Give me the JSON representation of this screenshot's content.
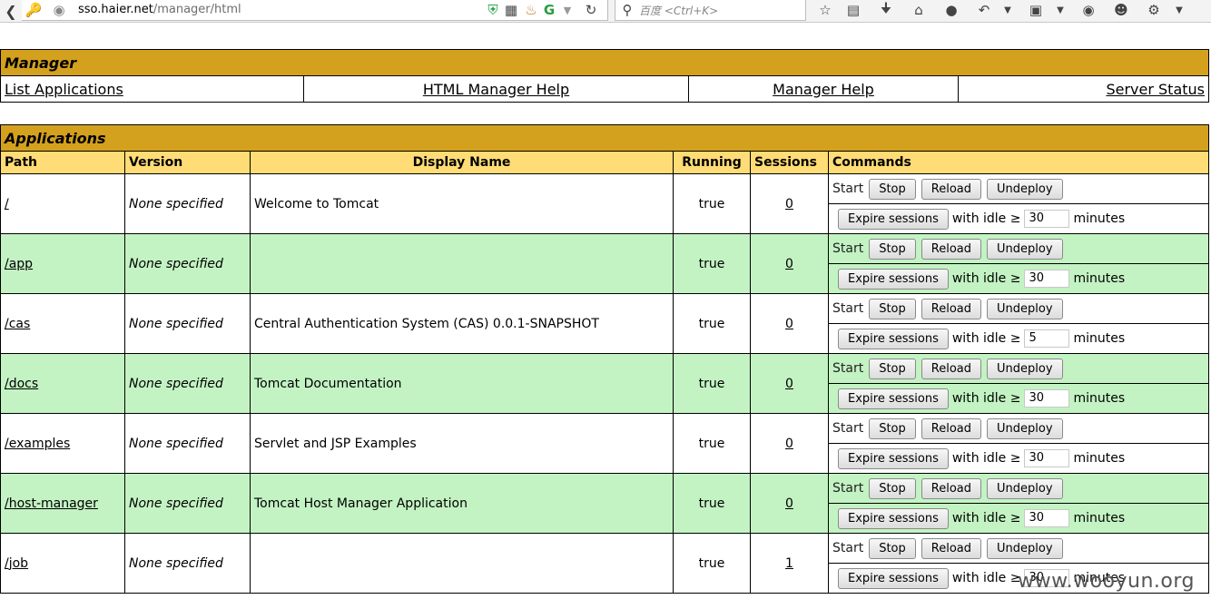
{
  "browser": {
    "url_host": "sso.haier.net",
    "url_path": "/manager/html",
    "search_placeholder": "百度 <Ctrl+K>"
  },
  "manager": {
    "title": "Manager",
    "nav": [
      "List Applications",
      "HTML Manager Help",
      "Manager Help",
      "Server Status"
    ]
  },
  "applications": {
    "title": "Applications",
    "columns": [
      "Path",
      "Version",
      "Display Name",
      "Running",
      "Sessions",
      "Commands"
    ],
    "commands": {
      "start": "Start",
      "stop": "Stop",
      "reload": "Reload",
      "undeploy": "Undeploy",
      "expire": "Expire sessions",
      "idle_label": "with idle ≥",
      "minutes": "minutes"
    },
    "rows": [
      {
        "path": "/",
        "version": "None specified",
        "display_name": "Welcome to Tomcat",
        "running": "true",
        "sessions": "0",
        "idle": "30"
      },
      {
        "path": "/app",
        "version": "None specified",
        "display_name": "",
        "running": "true",
        "sessions": "0",
        "idle": "30"
      },
      {
        "path": "/cas",
        "version": "None specified",
        "display_name": "Central Authentication System (CAS) 0.0.1-SNAPSHOT",
        "running": "true",
        "sessions": "0",
        "idle": "5"
      },
      {
        "path": "/docs",
        "version": "None specified",
        "display_name": "Tomcat Documentation",
        "running": "true",
        "sessions": "0",
        "idle": "30"
      },
      {
        "path": "/examples",
        "version": "None specified",
        "display_name": "Servlet and JSP Examples",
        "running": "true",
        "sessions": "0",
        "idle": "30"
      },
      {
        "path": "/host-manager",
        "version": "None specified",
        "display_name": "Tomcat Host Manager Application",
        "running": "true",
        "sessions": "0",
        "idle": "30"
      },
      {
        "path": "/job",
        "version": "None specified",
        "display_name": "",
        "running": "true",
        "sessions": "1",
        "idle": "30"
      }
    ]
  },
  "watermark": "www.wooyun.org",
  "colors": {
    "title_bg": "#d4a11e",
    "header_bg": "#ffdc75",
    "alt_row": "#c3f3c3"
  }
}
